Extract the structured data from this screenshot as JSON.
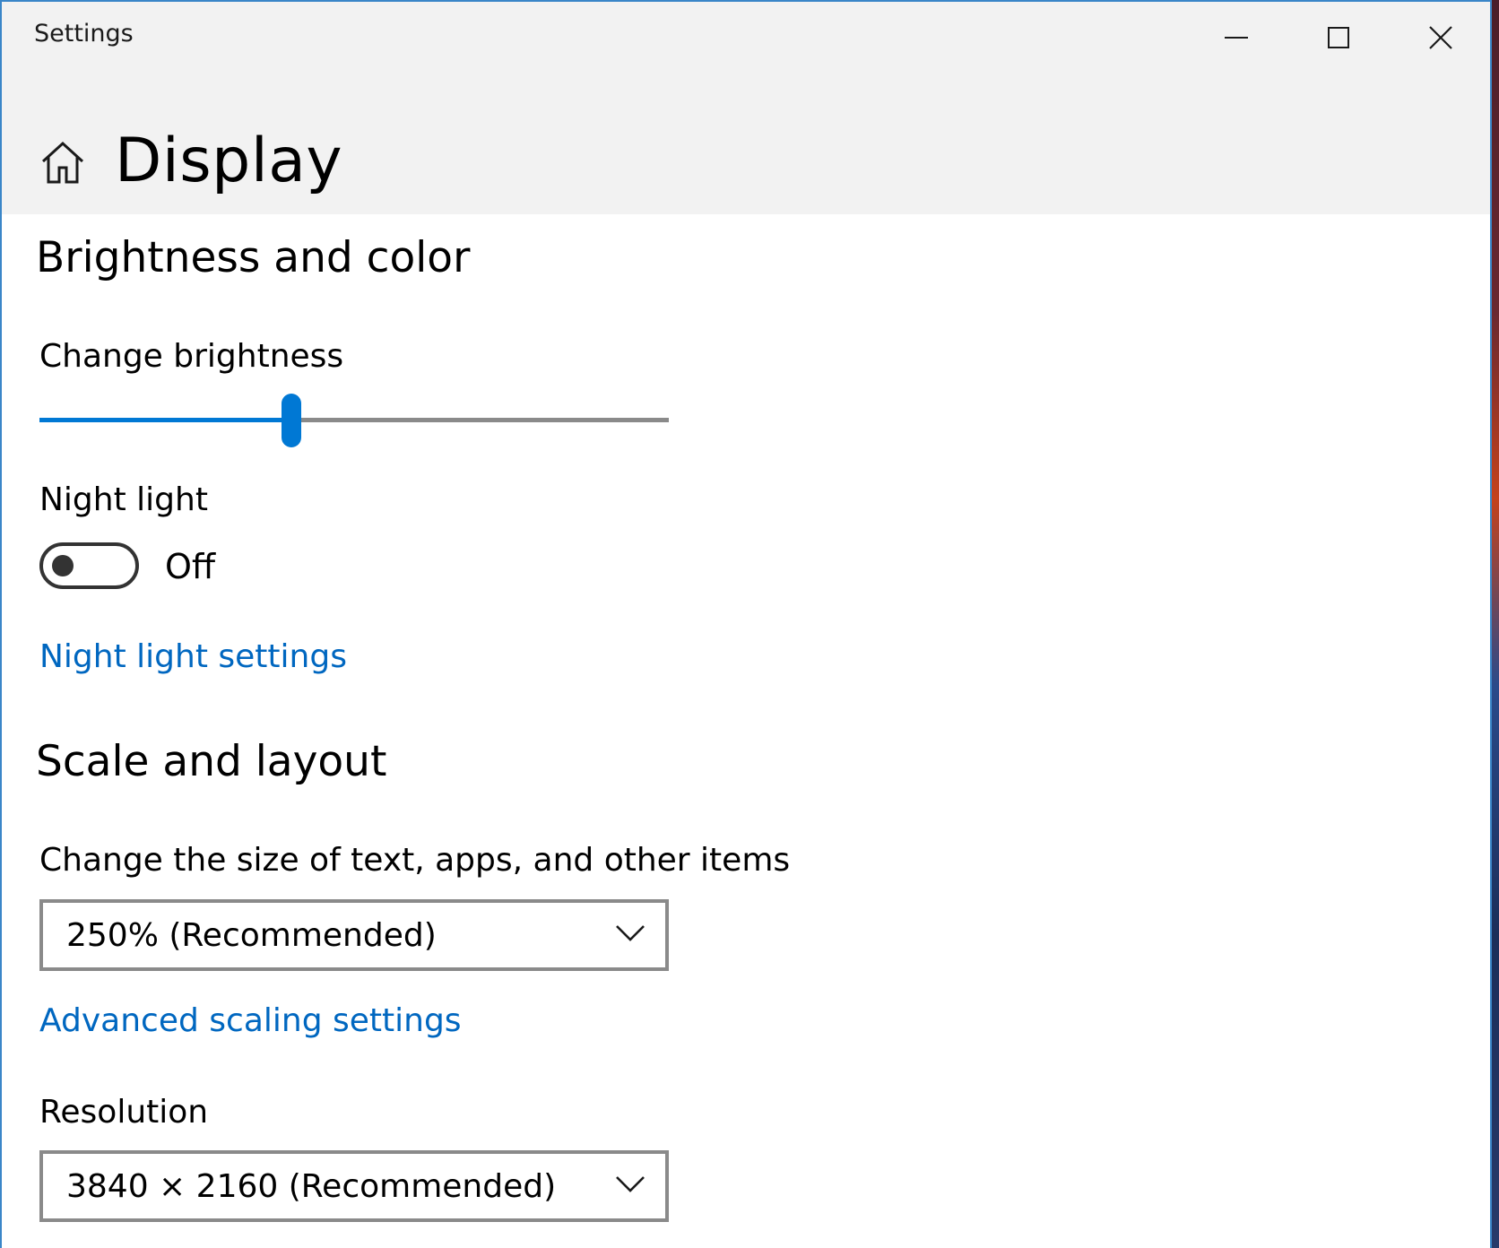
{
  "window": {
    "title": "Settings"
  },
  "page": {
    "title": "Display"
  },
  "brightness_section": {
    "heading": "Brightness and color",
    "brightness_label": "Change brightness",
    "brightness_level": 0.4,
    "night_light_label": "Night light",
    "night_light_state": "Off",
    "night_light_link": "Night light settings"
  },
  "scale_section": {
    "heading": "Scale and layout",
    "size_label": "Change the size of text, apps, and other items",
    "size_value": "250% (Recommended)",
    "advanced_link": "Advanced scaling settings",
    "resolution_label": "Resolution",
    "resolution_value": "3840 × 2160 (Recommended)"
  },
  "colors": {
    "accent": "#0078d4",
    "link": "#0067c0",
    "header_bg": "#f2f2f2"
  },
  "icons": [
    "home-icon",
    "minimize-icon",
    "maximize-icon",
    "close-icon",
    "chevron-down-icon"
  ]
}
